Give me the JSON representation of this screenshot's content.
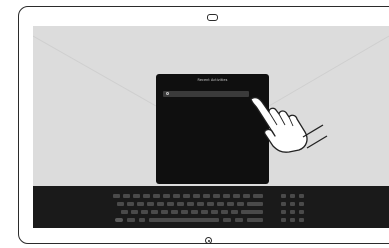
{
  "modal": {
    "title": "Recent Activities",
    "search_placeholder": ""
  },
  "colors": {
    "screen_bg": "#dcdcdc",
    "modal_bg": "#0f0f0f",
    "keyboard_bg": "#1a1a1a",
    "device_frame": "#2b2b2b"
  },
  "icons": {
    "camera": "camera-icon",
    "home": "home-button-icon",
    "search": "search-icon",
    "gesture": "hand-tap-icon"
  }
}
